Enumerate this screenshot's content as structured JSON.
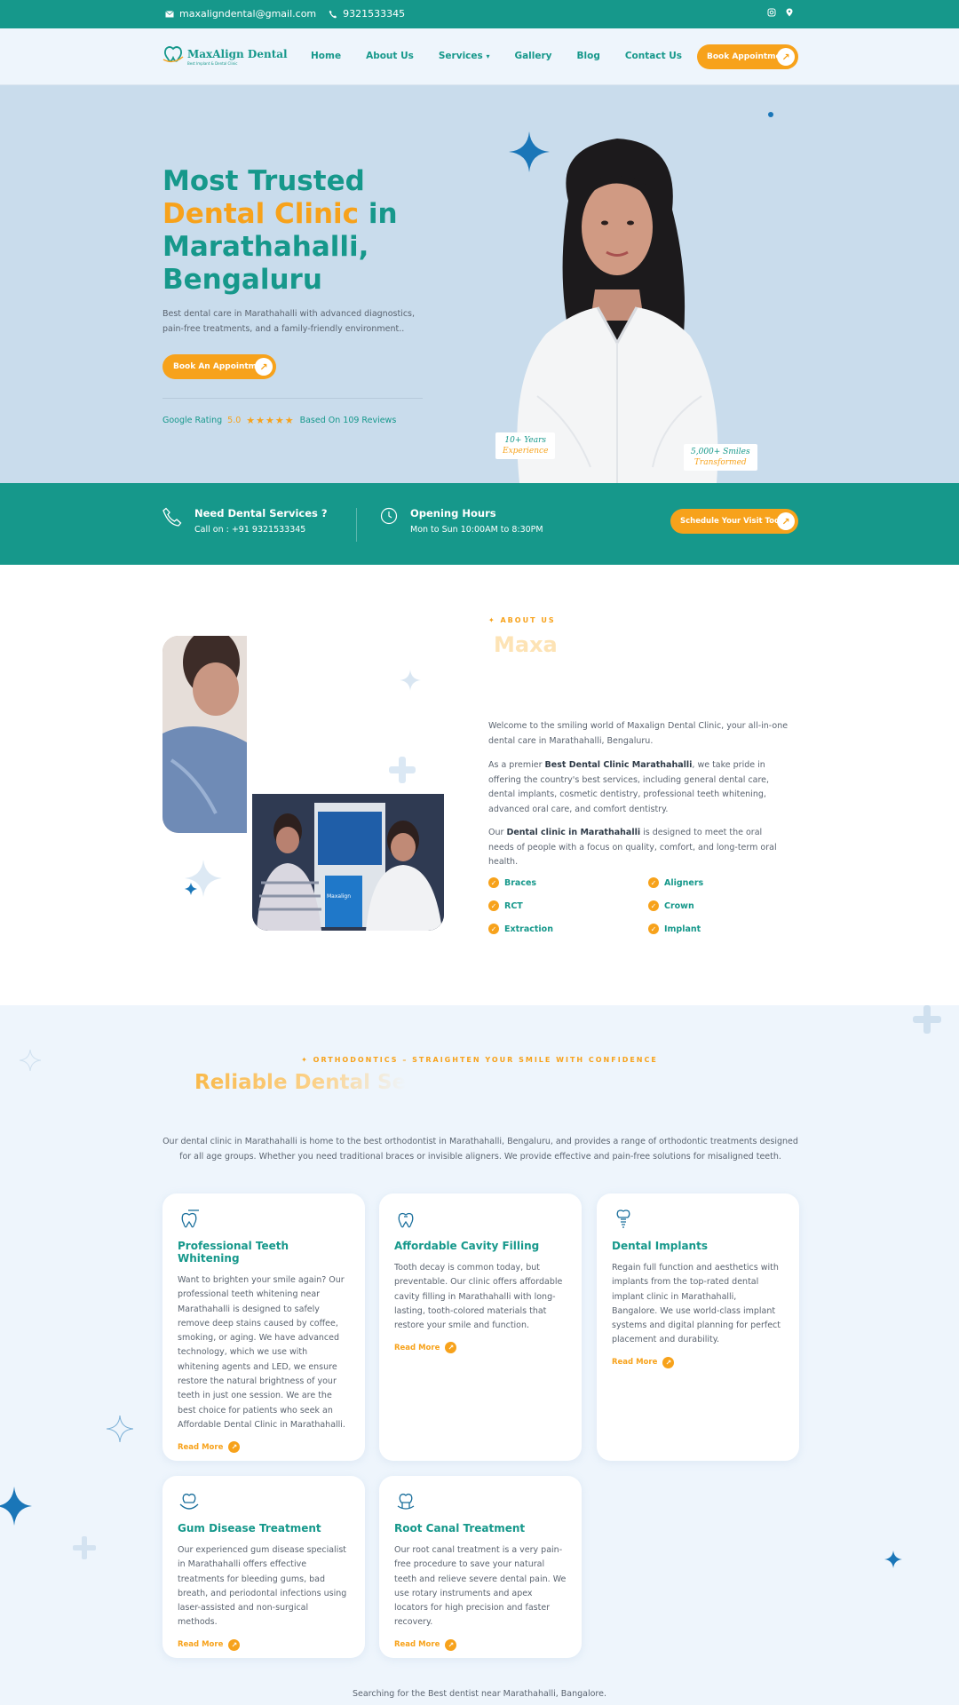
{
  "topbar": {
    "email": "maxaligndental@gmail.com",
    "phone": "9321533345",
    "social_icons": [
      "instagram-icon",
      "location-icon"
    ]
  },
  "nav": {
    "logo_name": "MaxAlign Dental",
    "logo_tagline": "Best Implant & Dental Clinic",
    "items": [
      "Home",
      "About Us",
      "Services",
      "Gallery",
      "Blog",
      "Contact Us"
    ],
    "cta": "Book Appointment"
  },
  "hero": {
    "title_1": "Most Trusted",
    "title_accent": "Dental Clinic",
    "title_2": " in Marathahalli, Bengaluru",
    "lead": "Best dental care in Marathahalli with advanced diagnostics, pain-free treatments, and a family-friendly environment..",
    "cta": "Book An Appointment",
    "rating_label": "Google Rating",
    "rating_score": "5.0",
    "stars": "★★★★★",
    "rating_count": "Based On 109 Reviews",
    "badge1_l1": "10+ Years",
    "badge1_l2": "Experience",
    "badge2_l1": "5,000+ Smiles",
    "badge2_l2": "Transformed"
  },
  "infoband": {
    "service_title": "Need Dental Services ?",
    "service_sub": "Call on : +91 9321533345",
    "hours_title": "Opening Hours",
    "hours_sub": "Mon to Sun 10:00AM to 8:30PM",
    "cta": "Schedule Your Visit Today"
  },
  "about": {
    "eyebrow": "✦ ABOUT US",
    "ghost_title": "Maxa",
    "p1": "Welcome to the smiling world of Maxalign Dental Clinic, your all-in-one dental care in Marathahalli, Bengaluru.",
    "p2_pre": "As a premier ",
    "p2_bold": "Best Dental Clinic Marathahalli",
    "p2_post": ", we take pride in offering the country's best services, including general dental care, dental implants, cosmetic dentistry, professional teeth whitening, advanced oral care, and comfort dentistry.",
    "p3_pre": "Our ",
    "p3_bold": "Dental clinic in Marathahalli",
    "p3_post": " is designed to meet the oral needs of people with a focus on quality, comfort, and long-term oral health.",
    "features": [
      "Braces",
      "Aligners",
      "RCT",
      "Crown",
      "Extraction",
      "Implant"
    ],
    "photo_bag_text": "Maxalign"
  },
  "ortho": {
    "eyebrow": "✦ ORTHODONTICS – STRAIGHTEN YOUR SMILE WITH CONFIDENCE",
    "ghost_title": "Reliable Dental Se",
    "intro": "Our dental clinic in Marathahalli is home to the best orthodontist in Marathahalli, Bengaluru, and provides a range of orthodontic treatments designed for all age groups. Whether you need traditional braces or invisible aligners. We provide effective and pain-free solutions for misaligned teeth.",
    "read_more": "Read More",
    "cards": [
      {
        "icon": "tooth-whitening-icon",
        "title": "Professional Teeth Whitening",
        "text": "Want to brighten your smile again? Our professional teeth whitening near Marathahalli is designed to safely remove deep stains caused by coffee, smoking, or aging. We have advanced technology, which we use with whitening agents and LED, we ensure restore the natural brightness of your teeth in just one session. We are the best choice for patients who seek an Affordable Dental Clinic in Marathahalli."
      },
      {
        "icon": "tooth-filling-icon",
        "title": "Affordable Cavity Filling",
        "text": "Tooth decay is common today, but preventable. Our clinic offers affordable cavity filling in Marathahalli with long-lasting, tooth-colored materials that restore your smile and function."
      },
      {
        "icon": "dental-implant-icon",
        "title": "Dental Implants",
        "text": "Regain full function and aesthetics with implants from the top-rated dental implant clinic in Marathahalli, Bangalore. We use world-class implant systems and digital planning for perfect placement and durability."
      },
      {
        "icon": "gum-treatment-icon",
        "title": "Gum Disease Treatment",
        "text": "Our experienced gum disease specialist in Marathahalli offers effective treatments for bleeding gums, bad breath, and periodontal infections using laser-assisted and non-surgical methods."
      },
      {
        "icon": "root-canal-icon",
        "title": "Root Canal Treatment",
        "text": "Our root canal treatment is a very pain-free procedure to save your natural teeth and relieve severe dental pain. We use rotary instruments and apex locators for high precision and faster recovery."
      }
    ],
    "footer_text": "Searching for the Best dentist near Marathahalli, Bangalore."
  }
}
